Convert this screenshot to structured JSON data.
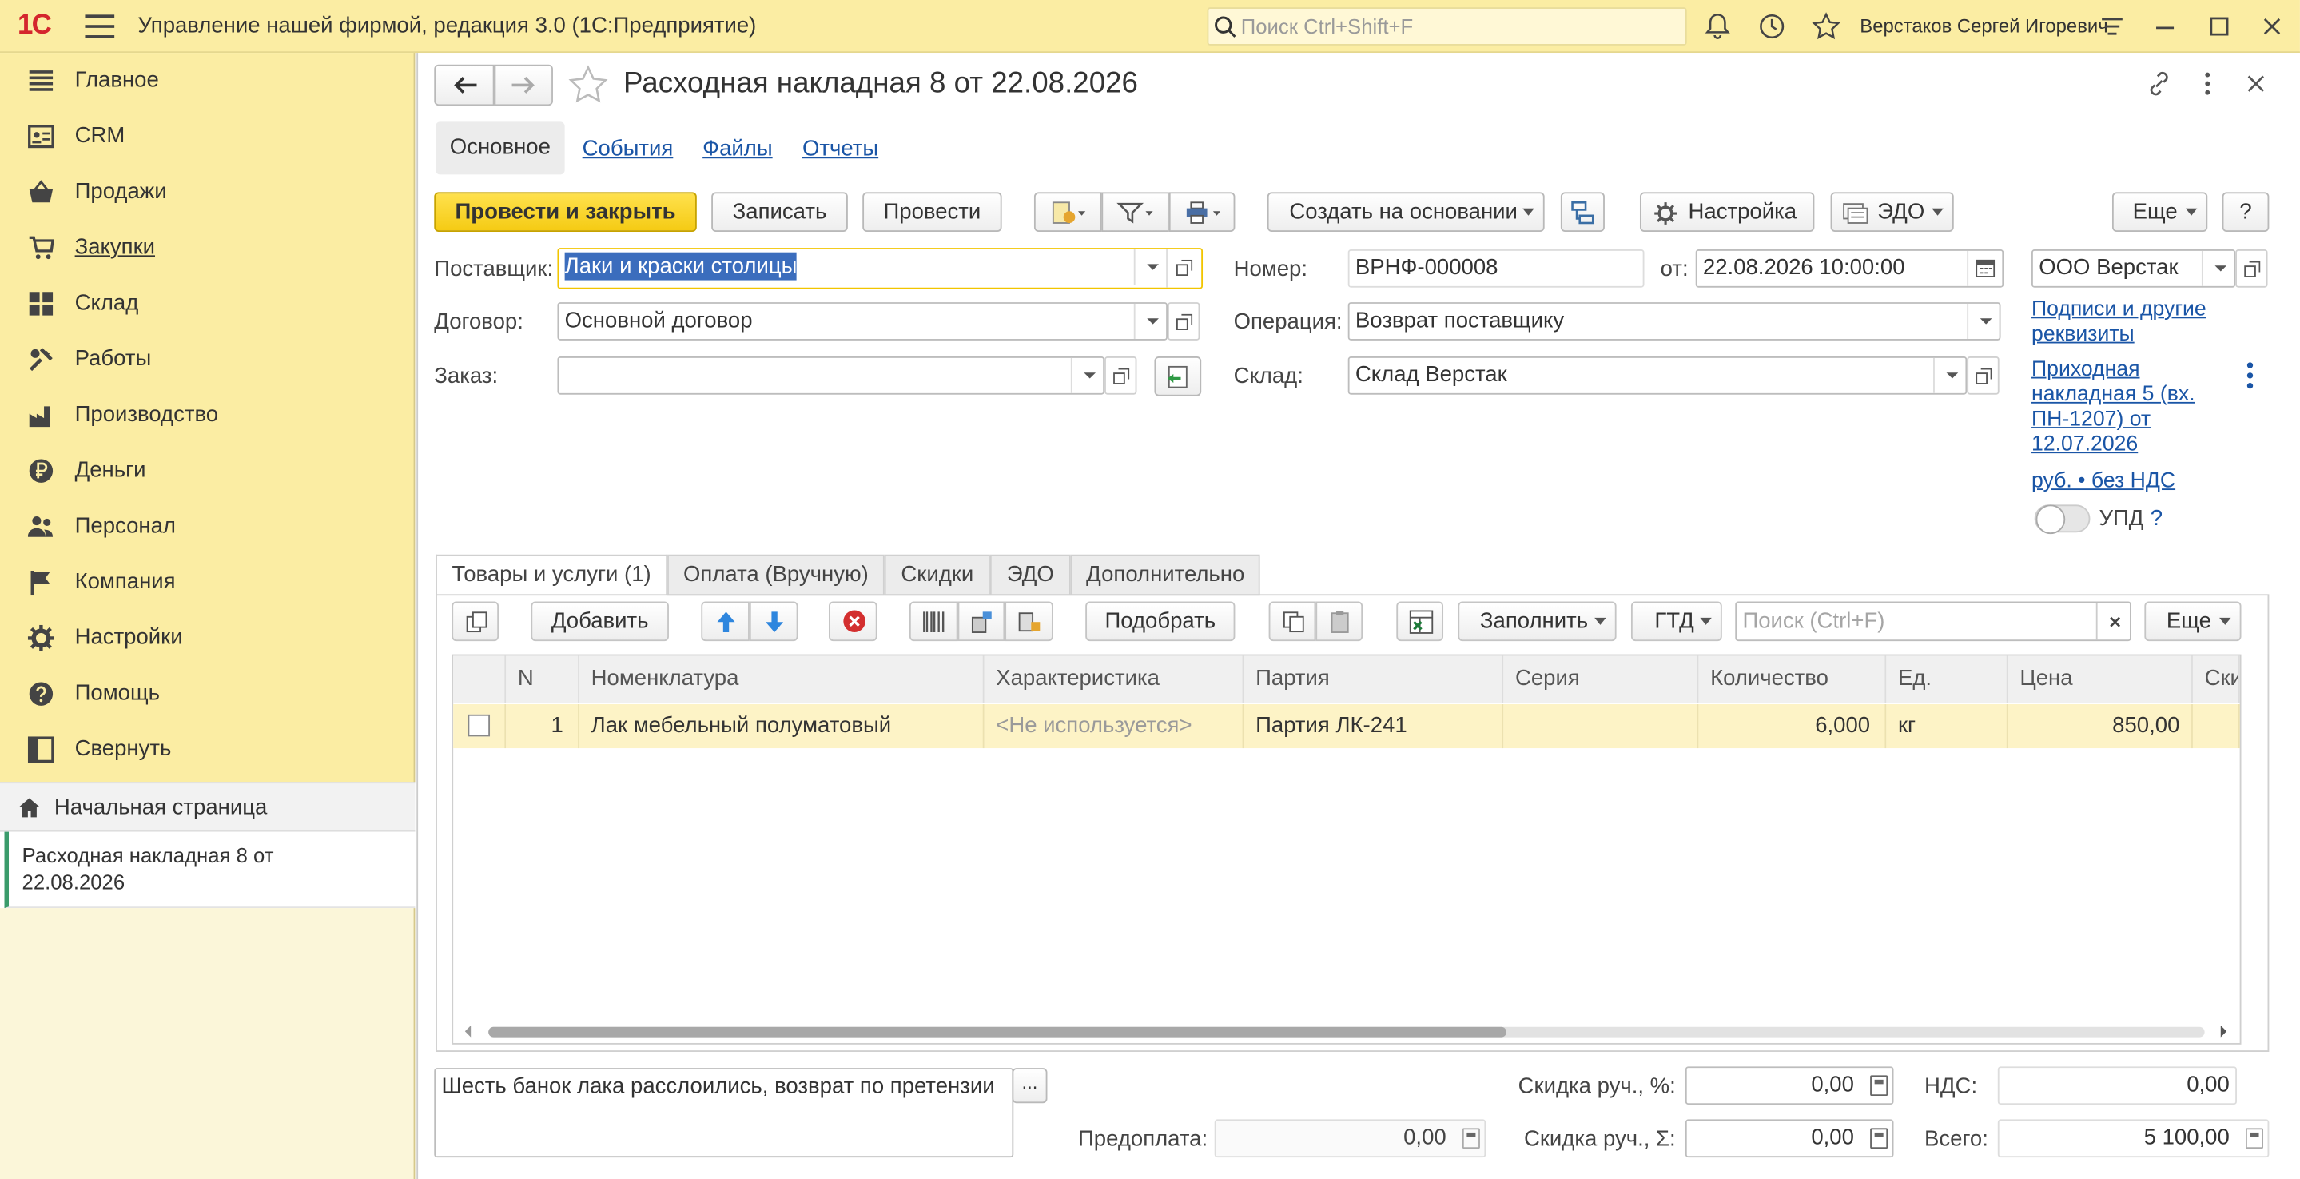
{
  "app": {
    "logo": "1С",
    "title": "Управление нашей фирмой, редакция 3.0  (1С:Предприятие)",
    "search_placeholder": "Поиск Ctrl+Shift+F",
    "user": "Верстаков Сергей Игоревич"
  },
  "sidebar": {
    "items": [
      {
        "label": "Главное",
        "icon": "list-icon"
      },
      {
        "label": "CRM",
        "icon": "contact-card-icon"
      },
      {
        "label": "Продажи",
        "icon": "basket-icon"
      },
      {
        "label": "Закупки",
        "icon": "cart-icon"
      },
      {
        "label": "Склад",
        "icon": "warehouse-grid-icon"
      },
      {
        "label": "Работы",
        "icon": "tools-icon"
      },
      {
        "label": "Производство",
        "icon": "factory-icon"
      },
      {
        "label": "Деньги",
        "icon": "ruble-coin-icon"
      },
      {
        "label": "Персонал",
        "icon": "people-icon"
      },
      {
        "label": "Компания",
        "icon": "flag-icon"
      },
      {
        "label": "Настройки",
        "icon": "gear-icon"
      },
      {
        "label": "Помощь",
        "icon": "help-icon"
      },
      {
        "label": "Свернуть",
        "icon": "collapse-panel-icon"
      }
    ],
    "home": "Начальная страница",
    "open_doc": "Расходная накладная 8 от 22.08.2026"
  },
  "doc": {
    "title": "Расходная накладная 8 от 22.08.2026",
    "tabs": [
      "Основное",
      "События",
      "Файлы",
      "Отчеты"
    ],
    "toolbar": {
      "post_close": "Провести и закрыть",
      "save": "Записать",
      "post": "Провести",
      "create_based": "Создать на основании",
      "settings": "Настройка",
      "edo": "ЭДО",
      "more": "Еще",
      "help": "?"
    },
    "fields": {
      "supplier_label": "Поставщик:",
      "supplier": "Лаки и краски столицы",
      "contract_label": "Договор:",
      "contract": "Основной договор",
      "order_label": "Заказ:",
      "order": "",
      "number_label": "Номер:",
      "number": "ВРНФ-000008",
      "date_label": "от:",
      "date": "22.08.2026 10:00:00",
      "operation_label": "Операция:",
      "operation": "Возврат поставщику",
      "warehouse_label": "Склад:",
      "warehouse": "Склад Верстак",
      "org": "ООО Верстак"
    },
    "links": {
      "signatures": "Подписи и другие реквизиты",
      "receipt": "Приходная накладная 5 (вх. ПН-1207) от 12.07.2026",
      "currency": "руб. • без НДС",
      "upd": "УПД",
      "upd_help": "?"
    },
    "inner_tabs": [
      "Товары и услуги (1)",
      "Оплата (Вручную)",
      "Скидки",
      "ЭДО",
      "Дополнительно"
    ],
    "table_toolbar": {
      "add": "Добавить",
      "pick": "Подобрать",
      "fill": "Заполнить",
      "gtd": "ГТД",
      "search_placeholder": "Поиск (Ctrl+F)",
      "more": "Еще"
    },
    "table": {
      "columns": [
        "N",
        "Номенклатура",
        "Характеристика",
        "Партия",
        "Серия",
        "Количество",
        "Ед.",
        "Цена",
        "Ски"
      ],
      "rows": [
        {
          "n": "1",
          "item": "Лак мебельный полуматовый",
          "char": "<Не используется>",
          "batch": "Партия ЛК-241",
          "series": "",
          "qty": "6,000",
          "unit": "кг",
          "price": "850,00"
        }
      ]
    },
    "comment": "Шесть банок лака расслоились, возврат по претензии",
    "totals": {
      "prepay_label": "Предоплата:",
      "prepay": "0,00",
      "disc_pct_label": "Скидка руч., %:",
      "disc_pct": "0,00",
      "disc_sum_label": "Скидка руч., Σ:",
      "disc_sum": "0,00",
      "vat_label": "НДС:",
      "vat": "0,00",
      "total_label": "Всего:",
      "total": "5 100,00"
    }
  }
}
